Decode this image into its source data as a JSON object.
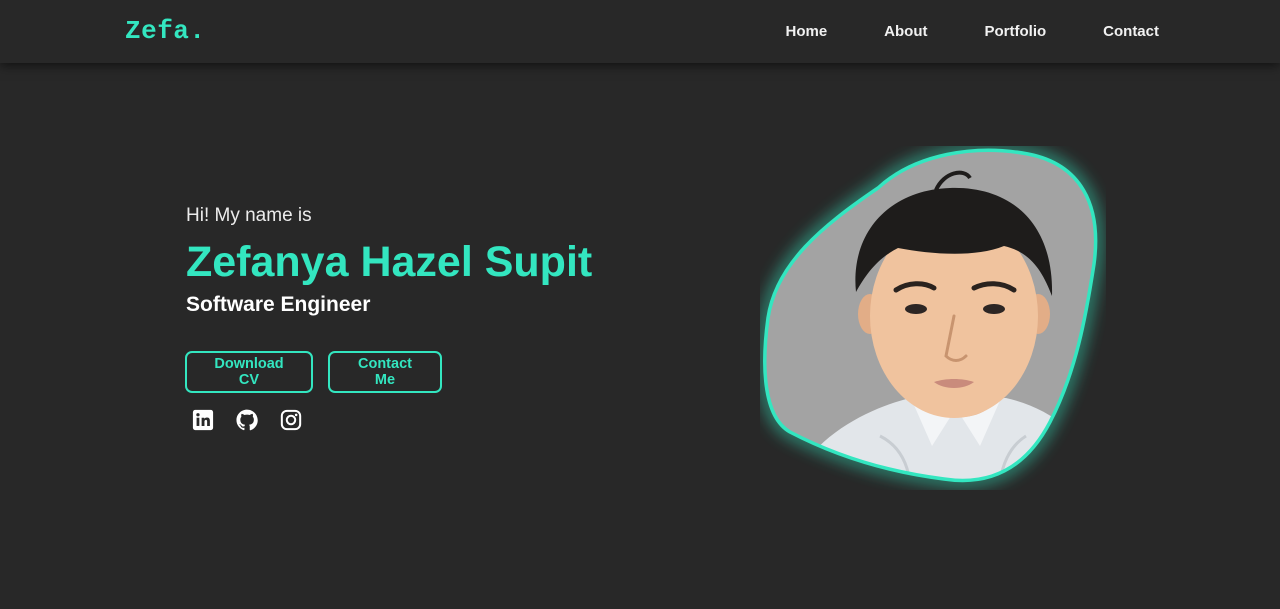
{
  "nav": {
    "logo": "Zefa.",
    "links": [
      "Home",
      "About",
      "Portfolio",
      "Contact"
    ]
  },
  "hero": {
    "greeting": "Hi! My name is",
    "name": "Zefanya Hazel Supit",
    "role": "Software Engineer",
    "buttons": {
      "download_cv": "Download CV",
      "contact_me": "Contact Me"
    },
    "social_icons": [
      "linkedin-icon",
      "github-icon",
      "instagram-icon"
    ]
  },
  "colors": {
    "background": "#282828",
    "accent": "#33e6c0",
    "text": "#f1f1f1",
    "photo_background": "#a3a3a3"
  }
}
